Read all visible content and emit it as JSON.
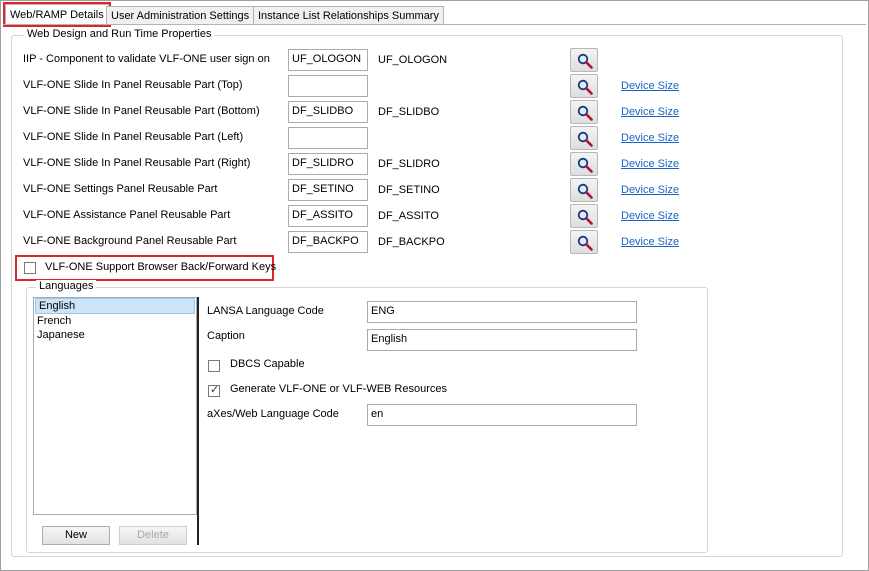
{
  "tabs": [
    {
      "label": "Web/RAMP Details",
      "active": true
    },
    {
      "label": "User Administration Settings",
      "active": false
    },
    {
      "label": "Instance List Relationships Summary",
      "active": false
    }
  ],
  "web_group": {
    "title": "Web Design and Run Time Properties",
    "rows": [
      {
        "label": "IIP - Component to validate VLF-ONE user sign on",
        "value": "UF_OLOGON",
        "display": "UF_OLOGON",
        "link": ""
      },
      {
        "label": "VLF-ONE Slide In Panel Reusable Part (Top)",
        "value": "",
        "display": "",
        "link": "Device Size"
      },
      {
        "label": "VLF-ONE Slide In Panel Reusable Part (Bottom)",
        "value": "DF_SLIDBO",
        "display": "DF_SLIDBO",
        "link": "Device Size"
      },
      {
        "label": "VLF-ONE Slide In Panel Reusable Part (Left)",
        "value": "",
        "display": "",
        "link": "Device Size"
      },
      {
        "label": "VLF-ONE Slide In Panel Reusable Part (Right)",
        "value": "DF_SLIDRO",
        "display": "DF_SLIDRO",
        "link": "Device Size"
      },
      {
        "label": "VLF-ONE Settings Panel Reusable Part",
        "value": "DF_SETINO",
        "display": "DF_SETINO",
        "link": "Device Size"
      },
      {
        "label": "VLF-ONE Assistance Panel Reusable Part",
        "value": "DF_ASSITO",
        "display": "DF_ASSITO",
        "link": "Device Size"
      },
      {
        "label": "VLF-ONE Background Panel Reusable Part",
        "value": "DF_BACKPO",
        "display": "DF_BACKPO",
        "link": "Device Size"
      }
    ],
    "browser_keys": {
      "label": "VLF-ONE Support Browser Back/Forward Keys",
      "checked": false
    }
  },
  "languages": {
    "title": "Languages",
    "items": [
      {
        "label": "English",
        "selected": true
      },
      {
        "label": "French",
        "selected": false
      },
      {
        "label": "Japanese",
        "selected": false
      }
    ],
    "new_label": "New",
    "delete_label": "Delete",
    "details": {
      "code_label": "LANSA Language Code",
      "code_value": "ENG",
      "caption_label": "Caption",
      "caption_value": "English",
      "dbcs_label": "DBCS Capable",
      "dbcs_checked": false,
      "generate_label": "Generate VLF-ONE or VLF-WEB Resources",
      "generate_checked": true,
      "axes_label": "aXes/Web Language Code",
      "axes_value": "en"
    }
  },
  "icons": {
    "lookup": "magnifier-icon"
  },
  "colors": {
    "highlight": "#e0242c",
    "link": "#1a64c8",
    "selection": "#cce4f7"
  }
}
